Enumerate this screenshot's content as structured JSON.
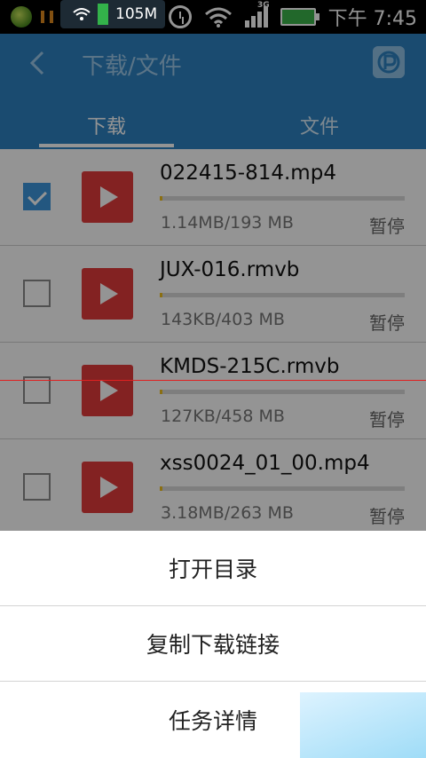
{
  "status_bar": {
    "time": "下午 7:45",
    "network_type": "3G",
    "icons": [
      "ball-app-icon",
      "pause-icon",
      "colorful-app-icon",
      "android-icon",
      "alarm-icon",
      "wifi-icon",
      "signal-icon",
      "battery-charging-icon"
    ],
    "battery_color": "#3bb34a"
  },
  "net_badge": {
    "speed": "105M"
  },
  "header": {
    "title": "下载/文件",
    "back_icon": "chevron-left-icon",
    "right_icon": "p-logo-icon",
    "color": "#2e82c2"
  },
  "tabs": [
    {
      "label": "下载",
      "active": true
    },
    {
      "label": "文件",
      "active": false
    }
  ],
  "downloads": [
    {
      "name": "022415-814.mp4",
      "size": "1.14MB/193 MB",
      "state": "暂停",
      "checked": true,
      "progress": 0.006
    },
    {
      "name": "JUX-016.rmvb",
      "size": "143KB/403 MB",
      "state": "暂停",
      "checked": false,
      "progress": 0.0004
    },
    {
      "name": "KMDS-215C.rmvb",
      "size": "127KB/458 MB",
      "state": "暂停",
      "checked": false,
      "progress": 0.0003
    },
    {
      "name": "xss0024_01_00.mp4",
      "size": "3.18MB/263 MB",
      "state": "暂停",
      "checked": false,
      "progress": 0.012
    }
  ],
  "menu": {
    "items": [
      "打开目录",
      "复制下载链接",
      "任务详情"
    ]
  }
}
